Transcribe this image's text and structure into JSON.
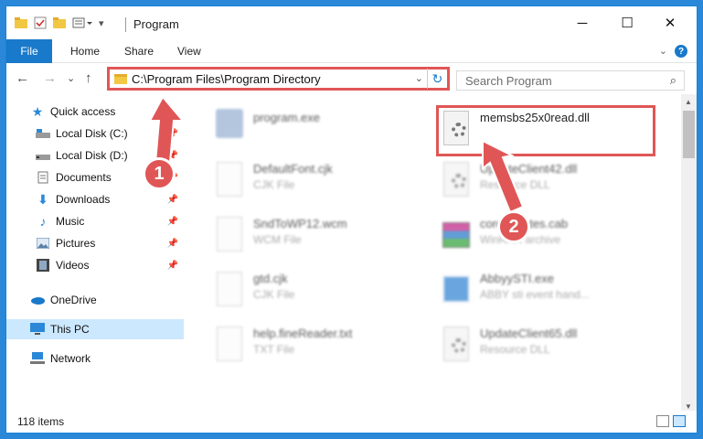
{
  "window": {
    "title": "Program"
  },
  "ribbon": {
    "file_label": "File",
    "tabs": [
      "Home",
      "Share",
      "View"
    ],
    "help_symbol": "?"
  },
  "titlebar_controls": {
    "minimize": "─",
    "maximize": "☐",
    "close": "✕"
  },
  "nav": {
    "back": "←",
    "forward": "→",
    "recent": "⌄",
    "up": "↑",
    "address": "C:\\Program Files\\Program Directory",
    "search_placeholder": "Search Program"
  },
  "sidebar": {
    "items": [
      {
        "label": "Quick access",
        "icon": "star-icon",
        "pinned": false
      },
      {
        "label": "Local Disk (C:)",
        "icon": "drive-icon",
        "pinned": true
      },
      {
        "label": "Local Disk (D:)",
        "icon": "drive-icon",
        "pinned": true
      },
      {
        "label": "Documents",
        "icon": "document-folder-icon",
        "pinned": true
      },
      {
        "label": "Downloads",
        "icon": "download-icon",
        "pinned": true
      },
      {
        "label": "Music",
        "icon": "music-icon",
        "pinned": true
      },
      {
        "label": "Pictures",
        "icon": "pictures-icon",
        "pinned": true
      },
      {
        "label": "Videos",
        "icon": "videos-icon",
        "pinned": true
      },
      {
        "label": "OneDrive",
        "icon": "cloud-icon",
        "pinned": false
      },
      {
        "label": "This PC",
        "icon": "computer-icon",
        "pinned": false,
        "selected": true
      },
      {
        "label": "Network",
        "icon": "network-icon",
        "pinned": false
      }
    ]
  },
  "files": [
    {
      "name": "program.exe",
      "type": "",
      "kind": "program",
      "blurred": true
    },
    {
      "name": "memsbs25x0read.dll",
      "type": "",
      "kind": "dll",
      "blurred": false,
      "highlighted": true
    },
    {
      "name": "DefaultFont.cjk",
      "type": "CJK File",
      "kind": "doc",
      "blurred": true
    },
    {
      "name": "UpdateClient42.dll",
      "type": "Resource DLL",
      "kind": "dll",
      "blurred": true
    },
    {
      "name": "SndToWP12.wcm",
      "type": "WCM File",
      "kind": "doc",
      "blurred": true
    },
    {
      "name": "coreupdates.cab",
      "type": "WinRAR archive",
      "kind": "cab",
      "blurred": true
    },
    {
      "name": "gtd.cjk",
      "type": "CJK File",
      "kind": "doc",
      "blurred": true
    },
    {
      "name": "AbbyySTI.exe",
      "type": "ABBY sti event hand...",
      "kind": "exe",
      "blurred": true
    },
    {
      "name": "help.fineReader.txt",
      "type": "TXT File",
      "kind": "doc",
      "blurred": true
    },
    {
      "name": "UpdateClient65.dll",
      "type": "Resource DLL",
      "kind": "dll",
      "blurred": true
    }
  ],
  "status": {
    "item_count": "118 items"
  },
  "annotations": {
    "step1": "1",
    "step2": "2",
    "color": "#e05656"
  }
}
